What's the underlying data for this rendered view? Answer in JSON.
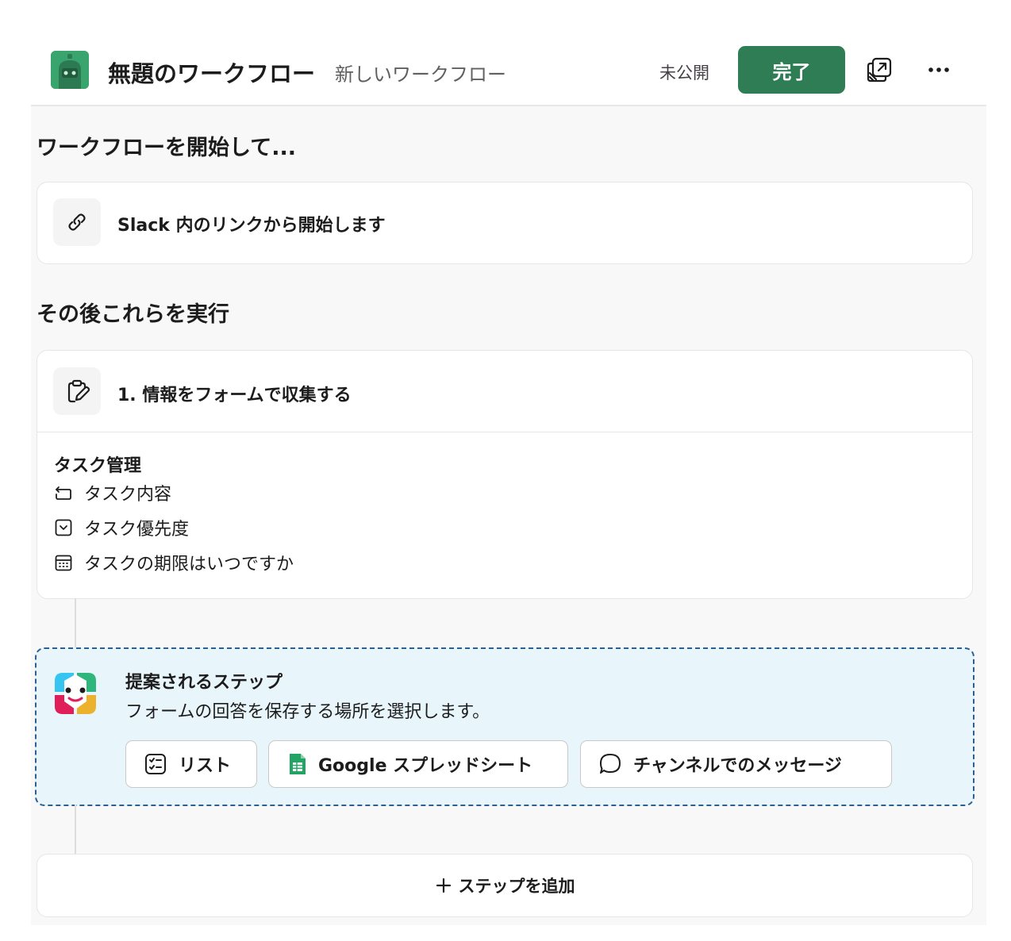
{
  "header": {
    "title": "無題のワークフロー",
    "subtitle": "新しいワークフロー",
    "status": "未公開",
    "done_label": "完了"
  },
  "trigger": {
    "heading": "ワークフローを開始して...",
    "label": "Slack 内のリンクから開始します"
  },
  "steps": {
    "heading": "その後これらを実行",
    "step1": {
      "label": "1. 情報をフォームで収集する",
      "form_title": "タスク管理",
      "fields": [
        {
          "icon": "text-field-icon",
          "label": "タスク内容"
        },
        {
          "icon": "dropdown-field-icon",
          "label": "タスク優先度"
        },
        {
          "icon": "calendar-field-icon",
          "label": "タスクの期限はいつですか"
        }
      ]
    }
  },
  "suggested": {
    "title": "提案されるステップ",
    "description": "フォームの回答を保存する場所を選択します。",
    "chips": [
      {
        "icon": "list-icon",
        "label": "リスト"
      },
      {
        "icon": "google-sheets-icon",
        "label": "Google スプレッドシート"
      },
      {
        "icon": "message-bubble-icon",
        "label": "チャンネルでのメッセージ"
      }
    ]
  },
  "add_step_label": "ステップを追加",
  "colors": {
    "accent": "#2e7d55",
    "suggest_bg": "#e8f6fc",
    "suggest_border": "#2e5f93",
    "app_icon": "#3aa46f"
  }
}
